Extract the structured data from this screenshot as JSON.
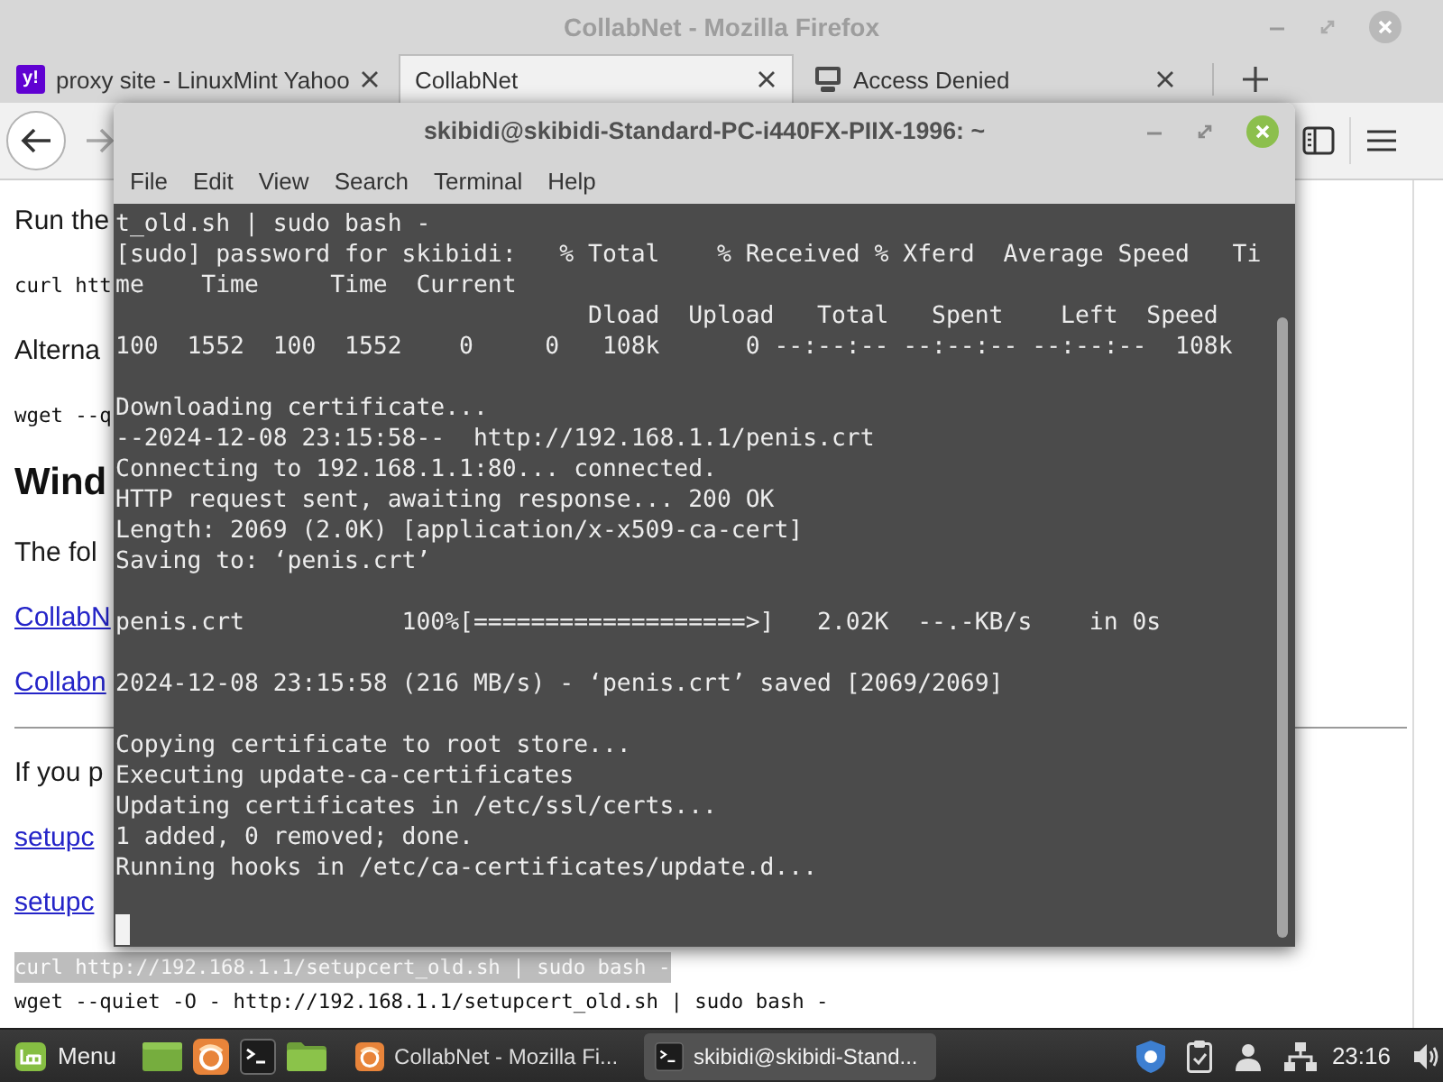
{
  "browser": {
    "title": "CollabNet - Mozilla Firefox",
    "focused": false,
    "tabs": [
      {
        "label": "proxy site - LinuxMint Yahoo",
        "favicon": {
          "kind": "letters",
          "text": "y!"
        },
        "selected": false
      },
      {
        "label": "CollabNet",
        "selected": true
      },
      {
        "label": "Access Denied",
        "favicon": {
          "kind": "computer"
        },
        "selected": false
      }
    ],
    "page": {
      "blocks": [
        {
          "kind": "paragraph",
          "text": "Run the"
        },
        {
          "kind": "code",
          "text": "curl htt"
        },
        {
          "kind": "paragraph",
          "text": "Alterna"
        },
        {
          "kind": "code",
          "text": "wget --q"
        },
        {
          "kind": "heading",
          "text": "Wind"
        },
        {
          "kind": "paragraph",
          "text": "The fol"
        },
        {
          "kind": "link",
          "text": "CollabN"
        },
        {
          "kind": "link",
          "text": "Collabn"
        },
        {
          "kind": "rule"
        },
        {
          "kind": "paragraph",
          "text": "If you p"
        },
        {
          "kind": "link",
          "text": "setupc"
        },
        {
          "kind": "link",
          "text": "setupc"
        },
        {
          "kind": "code_block",
          "lines": [
            {
              "text": "curl http://192.168.1.1/setupcert_old.sh | sudo bash -",
              "selected": true
            },
            {
              "text": "wget --quiet -O - http://192.168.1.1/setupcert_old.sh | sudo bash -",
              "selected": false
            }
          ]
        }
      ]
    }
  },
  "terminal": {
    "title": "skibidi@skibidi-Standard-PC-i440FX-PIIX-1996: ~",
    "focused": true,
    "menu": [
      "File",
      "Edit",
      "View",
      "Search",
      "Terminal",
      "Help"
    ],
    "output": [
      [
        "t_old.sh | sudo bash -",
        "[sudo] password for skibidi:   % Total    % Received % Xferd  Average Speed   Ti",
        "me    Time     Time  Current",
        "                                 Dload  Upload   Total   Spent    Left  Speed",
        "100  1552  100  1552    0     0   108k      0 --:--:-- --:--:-- --:--:--  108k"
      ],
      [
        "Downloading certificate...",
        "--2024-12-08 23:15:58--  http://192.168.1.1/penis.crt",
        "Connecting to 192.168.1.1:80... connected.",
        "HTTP request sent, awaiting response... 200 OK",
        "Length: 2069 (2.0K) [application/x-x509-ca-cert]",
        "Saving to: ‘penis.crt’"
      ],
      [
        "penis.crt           100%[===================>]   2.02K  --.-KB/s    in 0s"
      ],
      [
        "2024-12-08 23:15:58 (216 MB/s) - ‘penis.crt’ saved [2069/2069]"
      ],
      [
        "Copying certificate to root store...",
        "Executing update-ca-certificates",
        "Updating certificates in /etc/ssl/certs...",
        "1 added, 0 removed; done.",
        "Running hooks in /etc/ca-certificates/update.d..."
      ]
    ],
    "cursor": true
  },
  "taskbar": {
    "menu_label": "Menu",
    "windows": [
      {
        "label": "CollabNet - Mozilla Fi...",
        "kind": "browser",
        "selected": false
      },
      {
        "label": "skibidi@skibidi-Stand...",
        "kind": "terminal",
        "selected": true
      }
    ],
    "clock": "23:16"
  }
}
